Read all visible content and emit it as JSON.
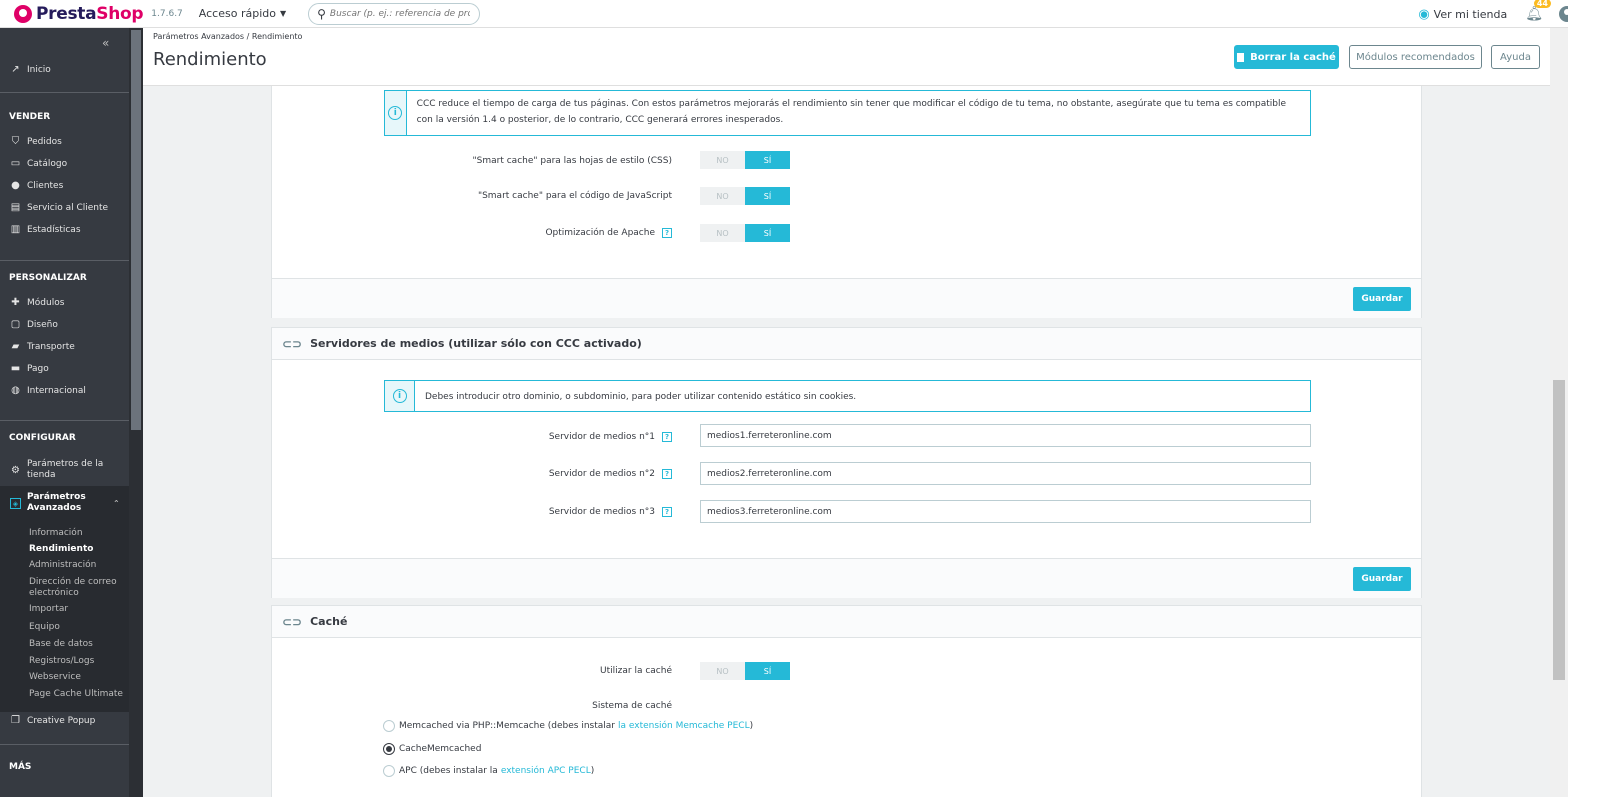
{
  "topbar": {
    "logo_part1": "Presta",
    "logo_part2": "Shop",
    "version": "1.7.6.7",
    "quick_access": "Acceso rápido",
    "search_placeholder": "Buscar (p. ej.: referencia de producto, n",
    "view_shop": "Ver mi tienda",
    "notifications_count": "44"
  },
  "sidebar": {
    "home": "Inicio",
    "sections": {
      "sell": "VENDER",
      "personalize": "PERSONALIZAR",
      "configure": "CONFIGURAR",
      "more": "MÁS"
    },
    "sell_items": [
      "Pedidos",
      "Catálogo",
      "Clientes",
      "Servicio al Cliente",
      "Estadísticas"
    ],
    "personalize_items": [
      "Módulos",
      "Diseño",
      "Transporte",
      "Pago",
      "Internacional"
    ],
    "configure_items": [
      "Parámetros de la tienda",
      "Parámetros Avanzados"
    ],
    "advanced_subitems": [
      "Información",
      "Rendimiento",
      "Administración",
      "Dirección de correo electrónico",
      "Importar",
      "Equipo",
      "Base de datos",
      "Registros/Logs",
      "Webservice",
      "Page Cache Ultimate"
    ],
    "creative_popup": "Creative Popup"
  },
  "header": {
    "breadcrumb_parent": "Parámetros Avanzados",
    "breadcrumb_current": "Rendimiento",
    "title": "Rendimiento",
    "clear_cache": "Borrar la caché",
    "recommended_modules": "Módulos recomendados",
    "help": "Ayuda"
  },
  "ccc_panel": {
    "alert": "CCC reduce el tiempo de carga de tus páginas. Con estos parámetros mejorarás el rendimiento sin tener que modificar el código de tu tema, no obstante, asegúrate que tu tema es compatible con la versión 1.4 o posterior, de lo contrario, CCC generará errores inesperados.",
    "rows": [
      {
        "label": "\"Smart cache\" para las hojas de estilo (CSS)",
        "no": "NO",
        "yes": "SÍ"
      },
      {
        "label": "\"Smart cache\" para el código de JavaScript",
        "no": "NO",
        "yes": "SÍ"
      },
      {
        "label": "Optimización de Apache",
        "no": "NO",
        "yes": "SÍ"
      }
    ],
    "save": "Guardar"
  },
  "media_panel": {
    "title": "Servidores de medios (utilizar sólo con CCC activado)",
    "alert": "Debes introducir otro dominio, o subdominio, para poder utilizar contenido estático sin cookies.",
    "fields": [
      {
        "label": "Servidor de medios n°1",
        "value": "medios1.ferreteronline.com"
      },
      {
        "label": "Servidor de medios n°2",
        "value": "medios2.ferreteronline.com"
      },
      {
        "label": "Servidor de medios n°3",
        "value": "medios3.ferreteronline.com"
      }
    ],
    "save": "Guardar"
  },
  "cache_panel": {
    "title": "Caché",
    "use_cache_label": "Utilizar la caché",
    "no": "NO",
    "yes": "SÍ",
    "system_label": "Sistema de caché",
    "options": [
      {
        "text": "Memcached via PHP::Memcache (debes instalar",
        "link": "la extensión Memcache PECL",
        "after": ")",
        "checked": false
      },
      {
        "text": "CacheMemcached",
        "link": "",
        "after": "",
        "checked": true
      },
      {
        "text": "APC (debes instalar la",
        "link": "extensión APC PECL",
        "after": ")",
        "checked": false
      }
    ]
  }
}
